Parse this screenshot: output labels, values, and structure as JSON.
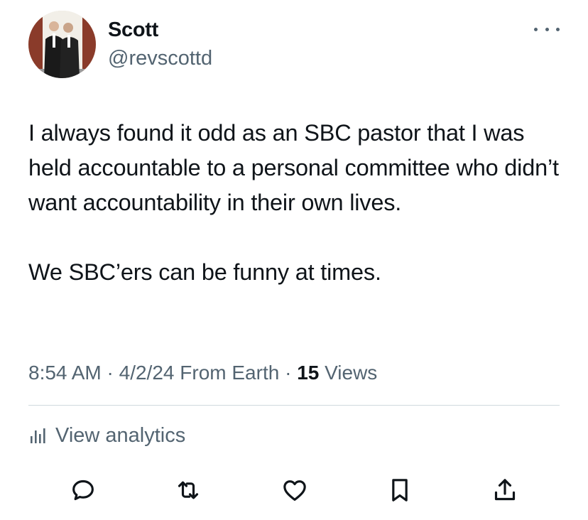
{
  "author": {
    "display_name": "Scott",
    "handle": "@revscottd"
  },
  "tweet": {
    "paragraphs": [
      "I always found it odd as an SBC pastor that I was held accountable to a personal committee who didn’t want accountability in their own lives.",
      "We SBC’ers can be funny at times."
    ]
  },
  "meta": {
    "time": "8:54 AM",
    "sep1": " · ",
    "date": "4/2/24",
    "source": " From Earth",
    "sep2": " · ",
    "views_count": "15",
    "views_label": " Views"
  },
  "analytics": {
    "label": "View analytics",
    "icon": "analytics-bars-icon"
  },
  "actions": [
    {
      "name": "reply",
      "icon": "reply-icon"
    },
    {
      "name": "retweet",
      "icon": "retweet-icon"
    },
    {
      "name": "like",
      "icon": "heart-icon"
    },
    {
      "name": "bookmark",
      "icon": "bookmark-icon"
    },
    {
      "name": "share",
      "icon": "share-icon"
    }
  ],
  "colors": {
    "text": "#0f1419",
    "secondary": "#536471",
    "divider": "#cfd9de"
  }
}
